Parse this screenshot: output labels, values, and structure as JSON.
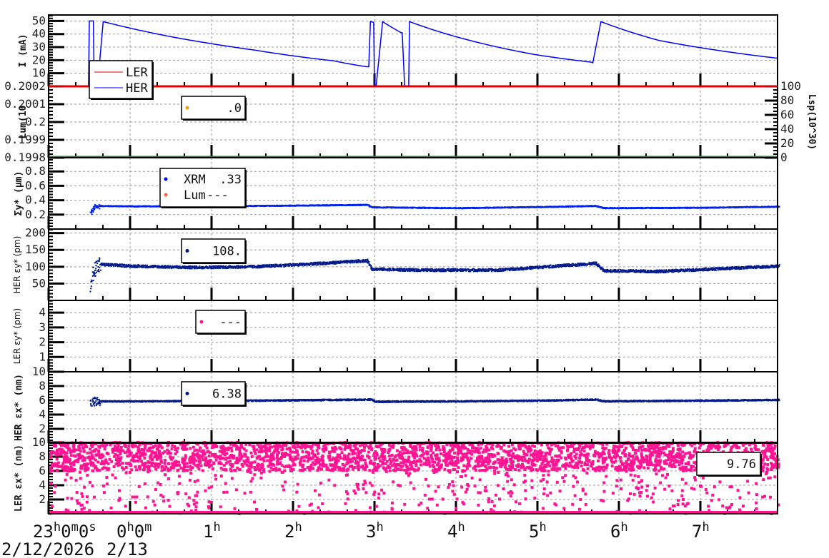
{
  "chart_data": [
    {
      "id": "current",
      "type": "line",
      "ylabel": "I (mA)",
      "ylim": [
        0,
        54.6
      ],
      "yticks": [
        "10",
        "20",
        "30",
        "40",
        "50"
      ],
      "ytick_values": [
        10,
        20,
        30,
        40,
        50
      ],
      "legend": [
        "LER",
        "HER"
      ],
      "series": [
        {
          "name": "LER",
          "color": "#e00000",
          "x": [
            0,
            8.95
          ],
          "y": [
            0,
            0
          ]
        },
        {
          "name": "HER",
          "color": "#0000ff",
          "x": [
            0,
            0.49,
            0.5,
            0.55,
            0.56,
            0.58,
            0.6,
            0.67,
            1.5,
            2.5,
            3.5,
            3.9,
            3.93,
            3.95,
            3.99,
            4.0,
            4.02,
            4.1,
            4.33,
            4.34,
            4.37,
            4.42,
            4.43,
            5.0,
            6.0,
            6.66,
            6.68,
            6.78,
            7.5,
            8.95
          ],
          "y": [
            0,
            0,
            50,
            50,
            0,
            0,
            0,
            49.5,
            38,
            28,
            19.5,
            15,
            15,
            49.5,
            49,
            0,
            0,
            49.5,
            41,
            41,
            0,
            0,
            49.5,
            38,
            24,
            18.5,
            18,
            49.5,
            35,
            21.5
          ]
        }
      ]
    },
    {
      "id": "luminosity",
      "type": "line",
      "ylabel": "Lum(10",
      "y2label": "Lsp(10^30)",
      "ylim": [
        0.1998,
        0.2002
      ],
      "yticks": [
        "0.2002",
        "0.2001",
        "0.2",
        "0.1999",
        "0.1998"
      ],
      "ytick_values": [
        0.2002,
        0.2001,
        0.2,
        0.1999,
        0.1998
      ],
      "y2lim": [
        0,
        100
      ],
      "y2ticks": [
        "100",
        "80",
        "60",
        "40",
        "20",
        "0"
      ],
      "y2tick_values": [
        100,
        80,
        60,
        40,
        20,
        0
      ],
      "legend": [
        {
          "value": ".0",
          "color": "#f0a000"
        }
      ],
      "series": [
        {
          "name": "Lsp",
          "color": "#2e7d32",
          "value": 0
        }
      ]
    },
    {
      "id": "sigma_y",
      "type": "scatter",
      "ylabel": "Σy* (μm)",
      "ylim": [
        0,
        0.99
      ],
      "yticks": [
        "0.8",
        "0.6",
        "0.4",
        "0.2"
      ],
      "ytick_values": [
        0.8,
        0.6,
        0.4,
        0.2
      ],
      "legend": [
        {
          "label": "XRM",
          "value": ".33",
          "color": "#0000ff"
        },
        {
          "label": "Lum",
          "value": "---",
          "color": "#ff6040"
        }
      ],
      "series": [
        {
          "name": "XRM",
          "color": "#0022ee",
          "noise": 0.006,
          "x": [
            0.5,
            0.55,
            0.62,
            1.0,
            2.0,
            3.0,
            3.9,
            3.95,
            4.0,
            5.0,
            6.0,
            6.7,
            6.8,
            8.0,
            8.95
          ],
          "y": [
            0.22,
            0.3,
            0.32,
            0.315,
            0.315,
            0.325,
            0.335,
            0.3,
            0.3,
            0.29,
            0.305,
            0.32,
            0.29,
            0.295,
            0.31
          ]
        }
      ]
    },
    {
      "id": "her_eps_y",
      "type": "scatter",
      "ylabel": "HER εy* (pm)",
      "ylim": [
        0,
        212
      ],
      "yticks": [
        "200",
        "150",
        "100",
        "50"
      ],
      "ytick_values": [
        200,
        150,
        100,
        50
      ],
      "legend": [
        {
          "value": "108.",
          "color": "#001a8c"
        }
      ],
      "series": [
        {
          "name": "HER",
          "color": "#001a8c",
          "noise": 4,
          "x": [
            0.5,
            0.55,
            0.62,
            1.0,
            1.7,
            2.5,
            3.2,
            3.9,
            3.95,
            4.5,
            5.5,
            6.7,
            6.8,
            7.5,
            8.95
          ],
          "y": [
            50,
            95,
            107,
            102,
            98,
            100,
            108,
            118,
            93,
            90,
            90,
            110,
            88,
            86,
            102
          ]
        }
      ]
    },
    {
      "id": "ler_eps_y",
      "type": "scatter",
      "ylabel": "LER εy* (pm)",
      "ylim": [
        0,
        4.83
      ],
      "yticks": [
        "4",
        "3",
        "2",
        "1"
      ],
      "ytick_values": [
        4,
        3,
        2,
        1
      ],
      "legend": [
        {
          "value": "---",
          "color": "#ff1493"
        }
      ],
      "series": []
    },
    {
      "id": "her_eps_x",
      "type": "scatter",
      "ylabel": "HER εx* (nm)",
      "ylim": [
        0,
        10
      ],
      "yticks": [
        "10",
        "8",
        "6",
        "4",
        "2"
      ],
      "ytick_values": [
        10,
        8,
        6,
        4,
        2
      ],
      "legend": [
        {
          "value": "6.38",
          "color": "#001a8c"
        }
      ],
      "series": [
        {
          "name": "HER",
          "color": "#001a8c",
          "noise": 0.1,
          "x": [
            0.5,
            0.62,
            1.0,
            2.0,
            3.0,
            3.95,
            4.0,
            5.0,
            6.0,
            6.7,
            6.8,
            8.0,
            8.95
          ],
          "y": [
            5.8,
            5.85,
            5.85,
            5.9,
            6.0,
            6.1,
            5.8,
            5.85,
            5.95,
            6.1,
            5.85,
            5.95,
            6.05
          ]
        }
      ]
    },
    {
      "id": "ler_eps_x",
      "type": "scatter",
      "ylabel": "LER εx* (nm)",
      "ylim": [
        0,
        10
      ],
      "yticks": [
        "10",
        "8",
        "6",
        "4",
        "2"
      ],
      "ytick_values": [
        10,
        8,
        6,
        4,
        2
      ],
      "legend": [
        {
          "value": "9.76",
          "color": "#ff1493"
        }
      ],
      "series": [
        {
          "name": "LER",
          "color": "#ff1493",
          "distribution": "random 0-10, dense 6-10, baseline at 0"
        }
      ]
    }
  ],
  "x_axis": {
    "range_hours_from_23h": [
      0,
      8.95
    ],
    "ticks": [
      {
        "value": 0,
        "label": "23",
        "sup": "h",
        "label2": "0",
        "sup2": "m",
        "label3": "0",
        "sup3": "s"
      },
      {
        "value": 1,
        "label": "0",
        "sup": "h",
        "label2": "0",
        "sup2": "m"
      },
      {
        "value": 2,
        "label": "1",
        "sup": "h"
      },
      {
        "value": 3,
        "label": "2",
        "sup": "h"
      },
      {
        "value": 4,
        "label": "3",
        "sup": "h"
      },
      {
        "value": 5,
        "label": "4",
        "sup": "h"
      },
      {
        "value": 6,
        "label": "5",
        "sup": "h"
      },
      {
        "value": 7,
        "label": "6",
        "sup": "h"
      },
      {
        "value": 8,
        "label": "7",
        "sup": "h"
      }
    ],
    "dates": [
      "2/12/2026",
      "2/13"
    ]
  }
}
